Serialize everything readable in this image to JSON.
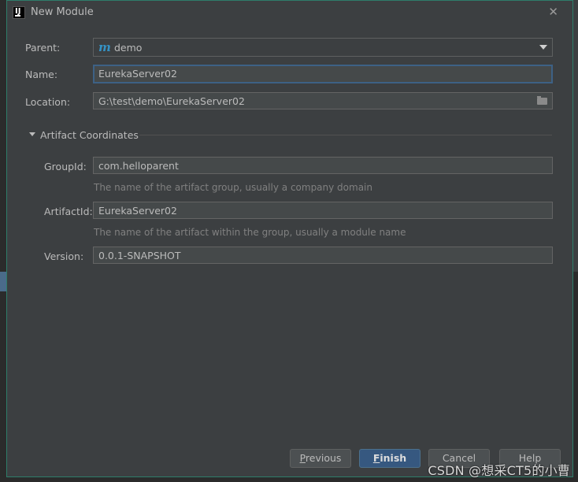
{
  "window": {
    "title": "New Module",
    "close_icon": "close-icon"
  },
  "form": {
    "parent_label": "Parent:",
    "parent_value": "demo",
    "name_label": "Name:",
    "name_value": "EurekaServer02",
    "location_label": "Location:",
    "location_value": "G:\\test\\demo\\EurekaServer02"
  },
  "artifact": {
    "section_title": "Artifact Coordinates",
    "groupid_label": "GroupId:",
    "groupid_value": "com.helloparent",
    "groupid_hint": "The name of the artifact group, usually a company domain",
    "artifactid_label": "ArtifactId:",
    "artifactid_value": "EurekaServer02",
    "artifactid_hint": "The name of the artifact within the group, usually a module name",
    "version_label": "Version:",
    "version_value": "0.0.1-SNAPSHOT"
  },
  "buttons": {
    "previous_mnemonic": "P",
    "previous_rest": "revious",
    "finish_mnemonic": "F",
    "finish_rest": "inish",
    "cancel": "Cancel",
    "help": "Help"
  },
  "watermark": "CSDN @想采CT5的小曹",
  "colors": {
    "accent": "#365880",
    "focus_border": "#3d6185",
    "maven_icon": "#3592c4",
    "background": "#3c3f41"
  }
}
